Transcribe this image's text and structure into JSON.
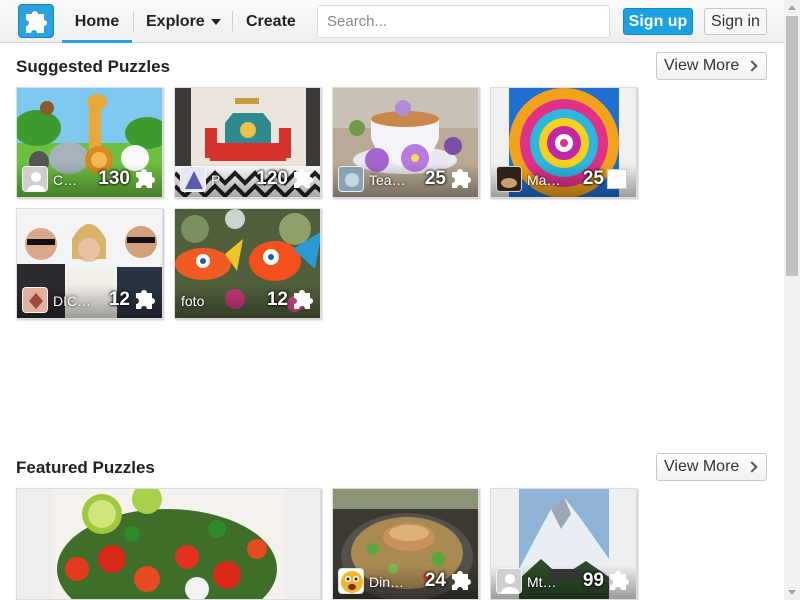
{
  "nav": {
    "home": "Home",
    "explore": "Explore",
    "create": "Create",
    "search_placeholder": "Search...",
    "signup": "Sign up",
    "signin": "Sign in"
  },
  "suggested": {
    "title": "Suggested Puzzles",
    "view_more": "View More",
    "tiles": [
      {
        "name": "C…",
        "count": "130",
        "art": "cartoon animals"
      },
      {
        "name": "P",
        "count": "120",
        "art": "living room interior"
      },
      {
        "name": "Tea…",
        "count": "25",
        "art": "tea cup with flowers"
      },
      {
        "name": "Ma…",
        "count": "25",
        "art": "kaleidoscope mandala"
      },
      {
        "name": "DIC…",
        "count": "12",
        "art": "three people photo"
      },
      {
        "name": "foto",
        "count": "12",
        "art": "fish sculptures"
      }
    ]
  },
  "featured": {
    "title": "Featured Puzzles",
    "view_more": "View More",
    "tiles": [
      {
        "name": "",
        "count": "",
        "art": "salad dish"
      },
      {
        "name": "Din…",
        "count": "24",
        "art": "grain bowl"
      },
      {
        "name": "Mt…",
        "count": "99",
        "art": "mountain poster"
      }
    ]
  },
  "colors": {
    "accent": "#1ba0e2",
    "logo": "#2aa1e0"
  },
  "icons": [
    "puzzle-logo-icon",
    "caret-down-icon",
    "chevron-right-icon",
    "puzzle-piece-icon",
    "user-avatar-icon"
  ]
}
